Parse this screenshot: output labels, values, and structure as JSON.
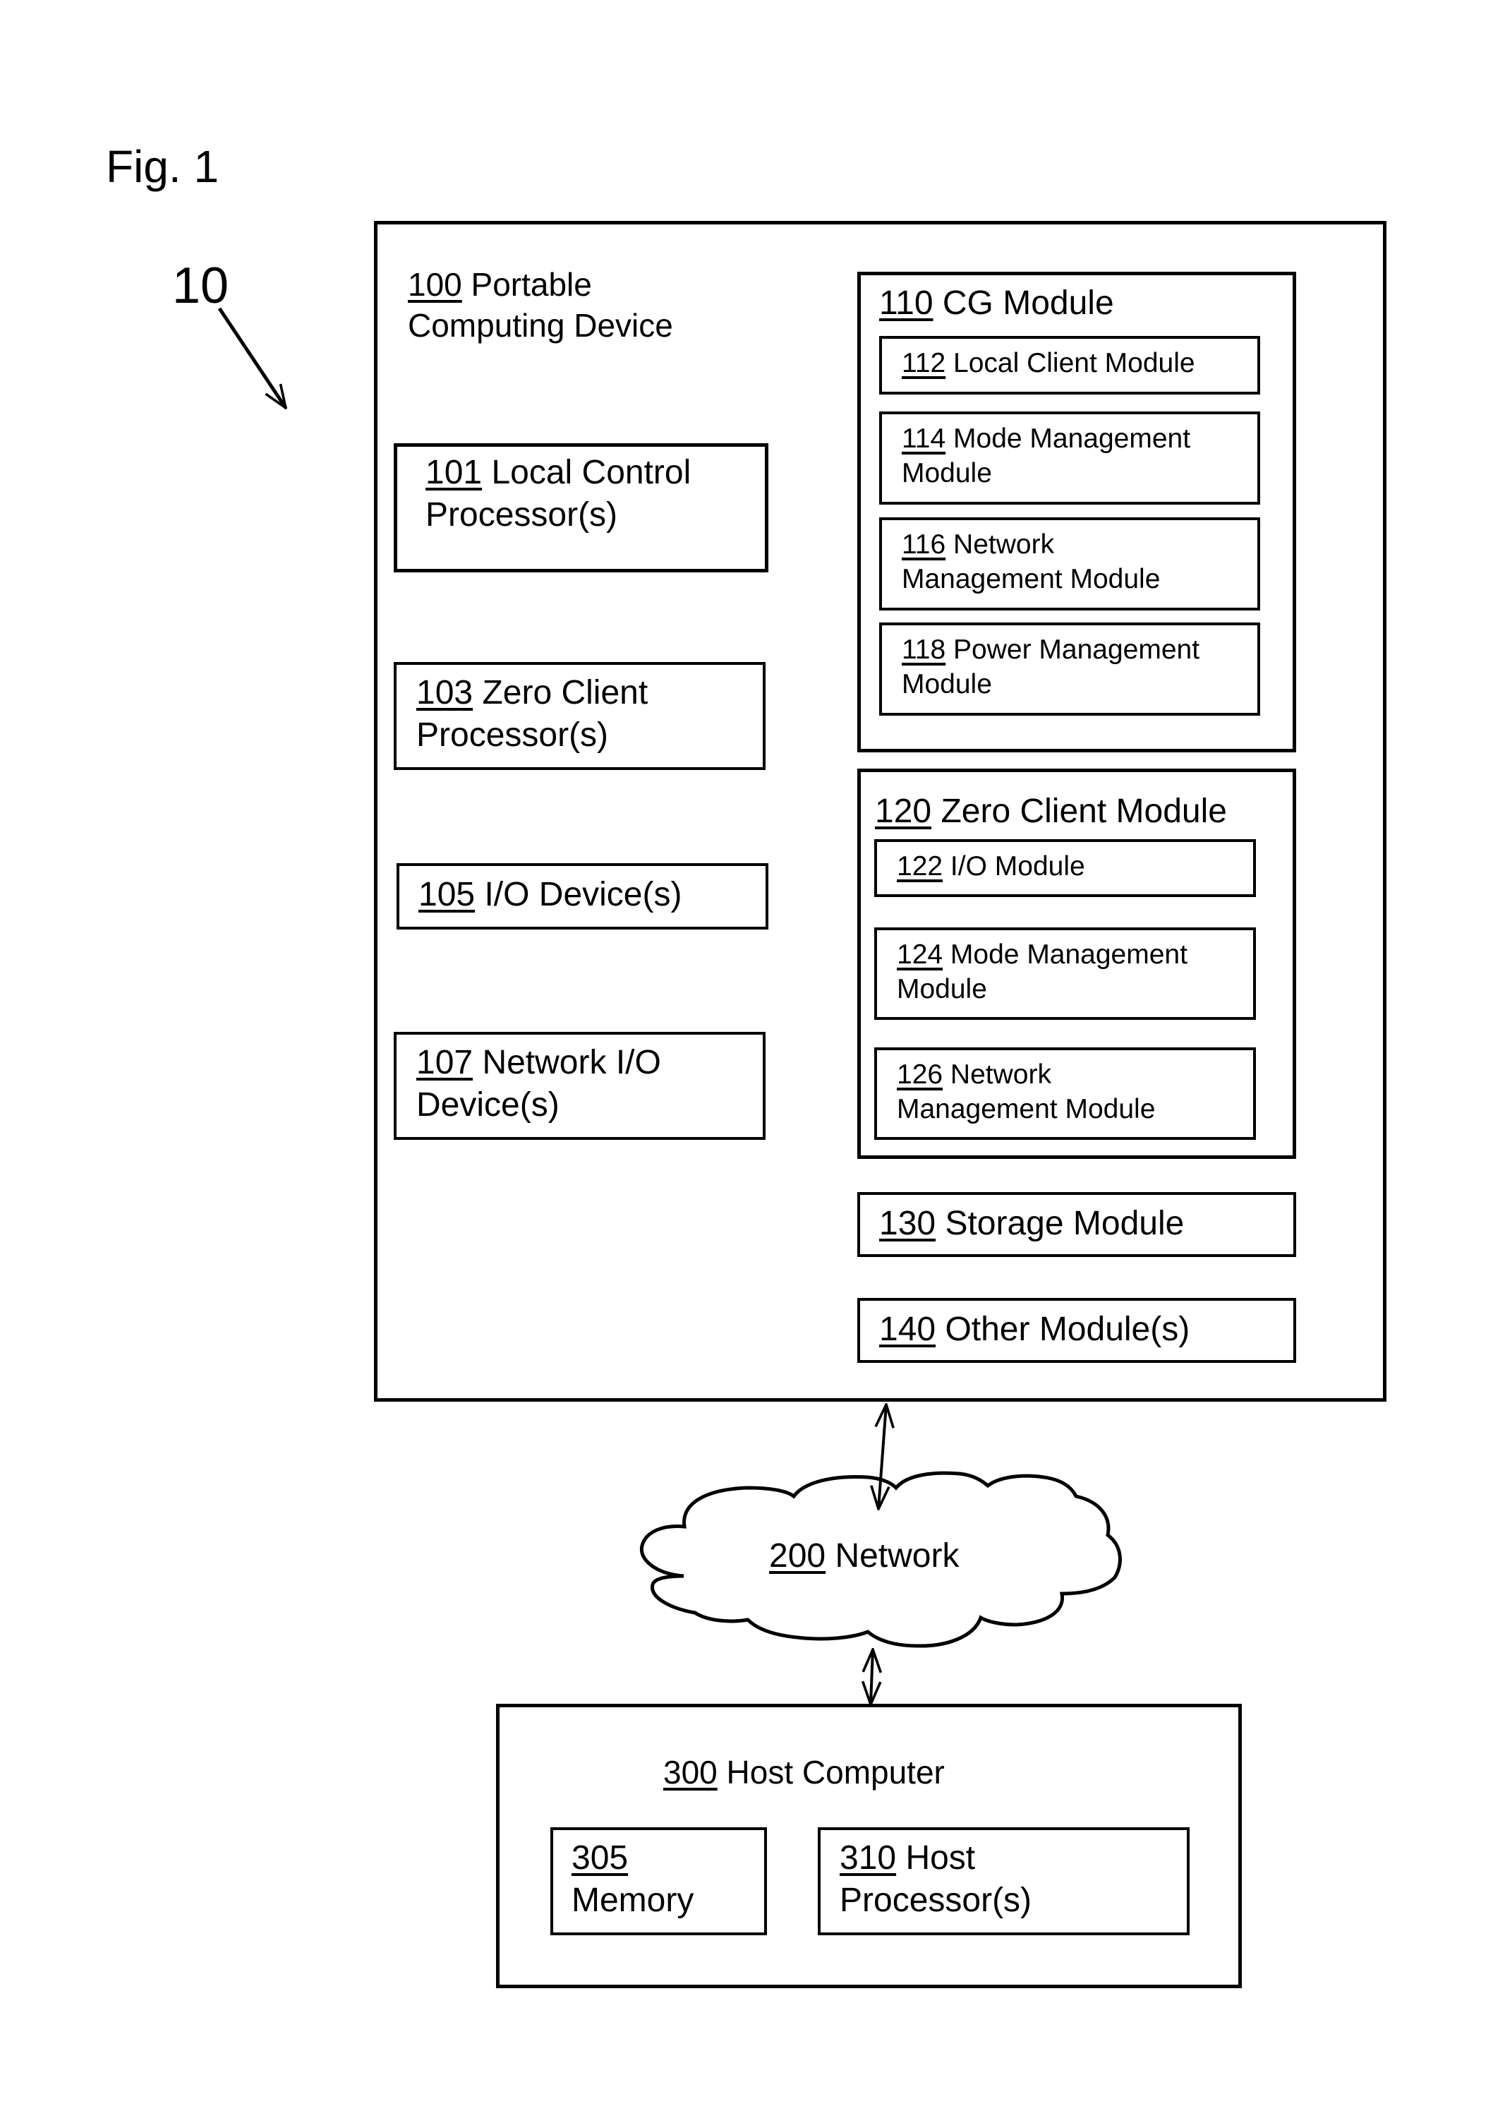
{
  "figure": {
    "title": "Fig. 1",
    "system_ref": "10"
  },
  "device": {
    "num": "100",
    "name_line1": "Portable",
    "name_line2": "Computing Device",
    "left_components": [
      {
        "num": "101",
        "line1": "Local Control",
        "line2": "Processor(s)"
      },
      {
        "num": "103",
        "line1": "Zero Client",
        "line2": "Processor(s)"
      },
      {
        "num": "105",
        "line1": "I/O Device(s)",
        "line2": ""
      },
      {
        "num": "107",
        "line1": "Network I/O",
        "line2": "Device(s)"
      }
    ],
    "cg_module": {
      "num": "110",
      "name": "CG Module",
      "submodules": [
        {
          "num": "112",
          "line1": "Local Client Module",
          "line2": ""
        },
        {
          "num": "114",
          "line1": "Mode Management",
          "line2": "Module"
        },
        {
          "num": "116",
          "line1": "Network",
          "line2": "Management Module"
        },
        {
          "num": "118",
          "line1": "Power Management",
          "line2": "Module"
        }
      ]
    },
    "zero_client_module": {
      "num": "120",
      "name": "Zero Client Module",
      "submodules": [
        {
          "num": "122",
          "line1": "I/O Module",
          "line2": ""
        },
        {
          "num": "124",
          "line1": "Mode Management",
          "line2": "Module"
        },
        {
          "num": "126",
          "line1": "Network",
          "line2": "Management Module"
        }
      ]
    },
    "storage_module": {
      "num": "130",
      "name": "Storage Module"
    },
    "other_modules": {
      "num": "140",
      "name": "Other Module(s)"
    }
  },
  "network": {
    "num": "200",
    "name": "Network"
  },
  "host": {
    "num": "300",
    "name": "Host Computer",
    "components": [
      {
        "num": "305",
        "line1": "",
        "line2": "Memory"
      },
      {
        "num": "310",
        "line1": "Host",
        "line2": "Processor(s)"
      }
    ]
  }
}
